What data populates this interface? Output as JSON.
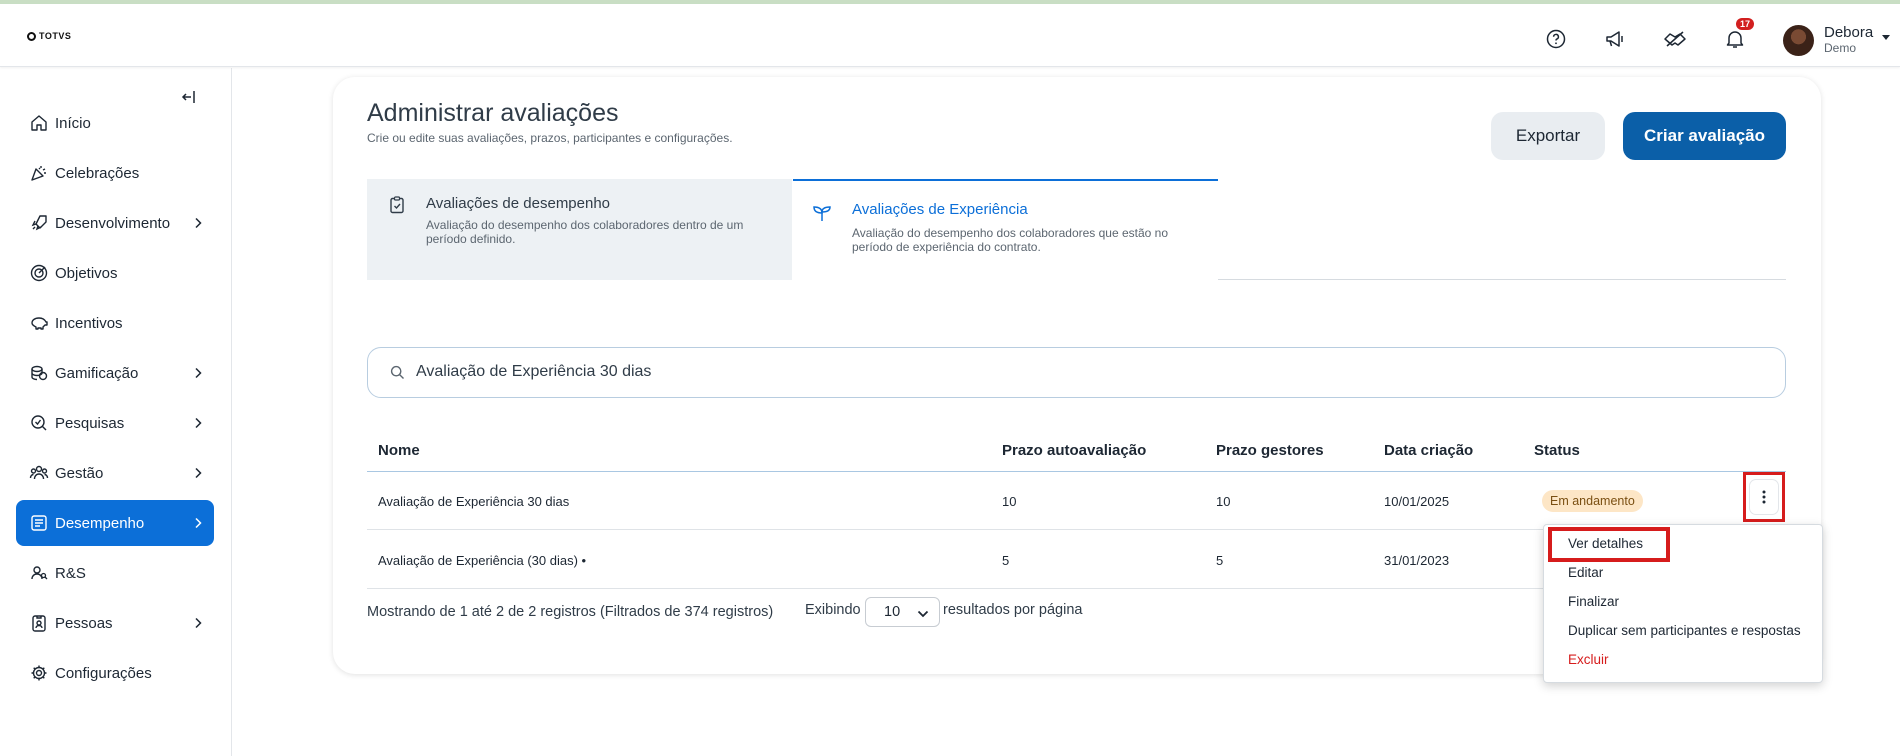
{
  "header": {
    "logo_text": "TOTVS",
    "notification_count": "17",
    "user_name": "Debora",
    "user_subtitle": "Demo",
    "icons": [
      "help-icon",
      "megaphone-icon",
      "handshake-icon",
      "bell-icon"
    ]
  },
  "sidebar": {
    "items": [
      {
        "label": "Início",
        "icon": "home-icon",
        "chevron": false,
        "active": false
      },
      {
        "label": "Celebrações",
        "icon": "party-icon",
        "chevron": false,
        "active": false
      },
      {
        "label": "Desenvolvimento",
        "icon": "rocket-icon",
        "chevron": true,
        "active": false
      },
      {
        "label": "Objetivos",
        "icon": "target-icon",
        "chevron": false,
        "active": false
      },
      {
        "label": "Incentivos",
        "icon": "piggy-bank-icon",
        "chevron": false,
        "active": false
      },
      {
        "label": "Gamificação",
        "icon": "coins-icon",
        "chevron": true,
        "active": false
      },
      {
        "label": "Pesquisas",
        "icon": "survey-icon",
        "chevron": true,
        "active": false
      },
      {
        "label": "Gestão",
        "icon": "team-icon",
        "chevron": true,
        "active": false
      },
      {
        "label": "Desempenho",
        "icon": "performance-icon",
        "chevron": true,
        "active": true
      },
      {
        "label": "R&S",
        "icon": "recruiting-icon",
        "chevron": false,
        "active": false
      },
      {
        "label": "Pessoas",
        "icon": "badge-icon",
        "chevron": true,
        "active": false
      },
      {
        "label": "Configurações",
        "icon": "gear-icon",
        "chevron": false,
        "active": false
      }
    ]
  },
  "page": {
    "title": "Administrar avaliações",
    "subtitle": "Crie ou edite suas avaliações, prazos, participantes e configurações.",
    "export_label": "Exportar",
    "create_label": "Criar avaliação"
  },
  "tabs": [
    {
      "title": "Avaliações de desempenho",
      "desc": "Avaliação do desempenho dos colaboradores dentro de um período definido.",
      "active": false
    },
    {
      "title": "Avaliações de Experiência",
      "desc": "Avaliação do desempenho dos colaboradores que estão no período de experiência do contrato.",
      "active": true
    }
  ],
  "search": {
    "value": "Avaliação de Experiência 30 dias"
  },
  "table": {
    "columns": [
      "Nome",
      "Prazo autoavaliação",
      "Prazo gestores",
      "Data criação",
      "Status"
    ],
    "rows": [
      {
        "name": "Avaliação de Experiência 30 dias",
        "self_deadline": "10",
        "manager_deadline": "10",
        "created": "10/01/2025",
        "status": "Em andamento"
      },
      {
        "name": "Avaliação de Experiência (30 dias) •",
        "self_deadline": "5",
        "manager_deadline": "5",
        "created": "31/01/2023",
        "status": ""
      }
    ]
  },
  "footer": {
    "summary": "Mostrando de 1 até 2 de 2 registros (Filtrados de 374 registros)",
    "show_label": "Exibindo",
    "page_size": "10",
    "per_page_label": "resultados por página"
  },
  "context_menu": {
    "items": [
      "Ver detalhes",
      "Editar",
      "Finalizar",
      "Duplicar sem participantes e respostas",
      "Excluir"
    ]
  },
  "colors": {
    "accent": "#0c6fd8",
    "primary_button": "#0b5fa8",
    "danger": "#d61c1c",
    "status_badge": "#fde6c6"
  }
}
